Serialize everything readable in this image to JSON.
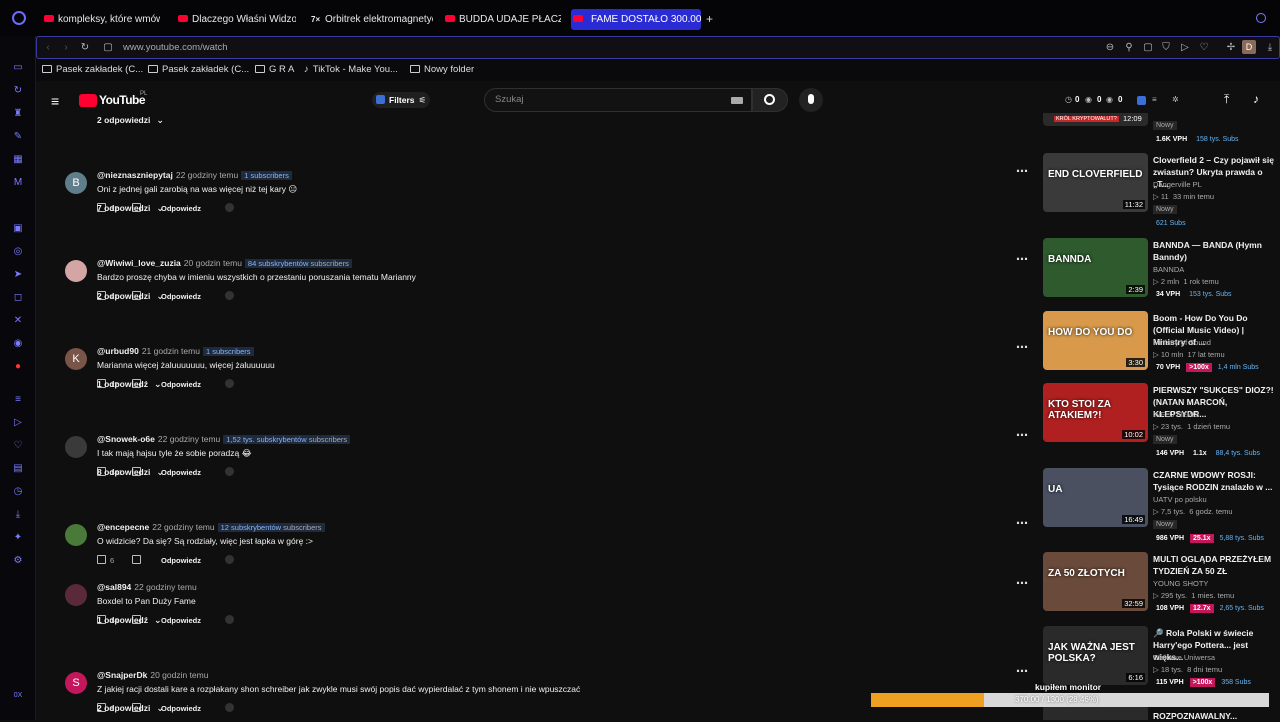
{
  "browser": {
    "tabs": [
      {
        "label": "kompleksy, które wmówiły",
        "yt": true
      },
      {
        "label": "Dlaczego Właśni Widzowie",
        "yt": true
      },
      {
        "label": "Orbitrek elektromagnetyczny",
        "yt": false
      },
      {
        "label": "BUDDA UDAJE PŁACZ I WY",
        "yt": true
      },
      {
        "label": "FAME DOSTAŁO 300.000",
        "yt": true,
        "active": true
      }
    ],
    "url": "www.youtube.com/watch",
    "profile_letter": "D",
    "bookmarks": [
      "Pasek zakładek (C...",
      "Pasek zakładek (C...",
      "G R A",
      "TikTok - Make You...",
      "Nowy folder"
    ],
    "sidebar_bottom_label": "0X"
  },
  "yt": {
    "logo": "YouTube",
    "logo_region": "PL",
    "filters_label": "Filters",
    "search_placeholder": "Szukaj",
    "header_counters": [
      "0",
      "0",
      "0"
    ]
  },
  "comments": [
    {
      "type": "replies",
      "label": "2 odpowiedzi"
    },
    {
      "type": "comment",
      "avatar": "B",
      "avatar_color": "#607d8b",
      "author": "@nieznaszniepytaj",
      "time": "22 godziny temu",
      "subs": "1 subscribers",
      "subs_extra": "",
      "text": "Oni z jednej gali zarobią na was więcej niż tej kary 😐",
      "likes": "32",
      "reply": "Odpowiedz"
    },
    {
      "type": "replies",
      "label": "7 odpowiedzi"
    },
    {
      "type": "comment",
      "avatar": "",
      "avatar_color": "#d4a5a5",
      "author": "@Wiwiwi_love_zuzia",
      "time": "20 godzin temu",
      "subs": "84 subskrybentów",
      "subs_extra": "subscribers",
      "text": "Bardzo proszę chyba w imieniu wszystkich o przestaniu poruszania tematu Marianny",
      "likes": "41",
      "reply": "Odpowiedz"
    },
    {
      "type": "replies",
      "label": "2 odpowiedzi"
    },
    {
      "type": "comment",
      "avatar": "K",
      "avatar_color": "#795548",
      "author": "@urbud90",
      "time": "21 godzin temu",
      "subs": "1 subscribers",
      "subs_extra": "",
      "text": "Marianna więcej żaluuuuuuu, więcej żaluuuuuu",
      "likes": "12",
      "reply": "Odpowiedz"
    },
    {
      "type": "replies",
      "label": "1 odpowiedź"
    },
    {
      "type": "comment",
      "avatar": "",
      "avatar_color": "#3a3a3a",
      "author": "@Snowek-o6e",
      "time": "22 godziny temu",
      "subs": "1,52 tys. subskrybentów",
      "subs_extra": "subscribers",
      "text": "I tak mają hajsu tyle że sobie poradzą 😂",
      "likes": "141",
      "reply": "Odpowiedz"
    },
    {
      "type": "replies",
      "label": "8 odpowiedzi"
    },
    {
      "type": "comment",
      "avatar": "",
      "avatar_color": "#4a7a3a",
      "author": "@encepecne",
      "time": "22 godziny temu",
      "subs": "12 subskrybentów",
      "subs_extra": "subscribers",
      "text": "O widzicie? Da się? Są rodziały, więc jest łapka w górę :>",
      "likes": "6",
      "reply": "Odpowiedz"
    },
    {
      "type": "comment",
      "avatar": "",
      "avatar_color": "#5a2a3a",
      "author": "@sal894",
      "time": "22 godziny temu",
      "subs": "",
      "subs_extra": "",
      "text": "Boxdel to Pan Duży Fame",
      "likes": "14",
      "reply": "Odpowiedz"
    },
    {
      "type": "replies",
      "label": "1 odpowiedź"
    },
    {
      "type": "comment",
      "avatar": "S",
      "avatar_color": "#c2185b",
      "author": "@SnajperDk",
      "time": "20 godzin temu",
      "subs": "",
      "subs_extra": "",
      "text": "Z jakiej racji dostali kare a rozpłakany shon schreiber jak zwykle musi swój popis dać wypierdalać z tym shonem i nie wpuszczać",
      "likes": "8",
      "reply": "Odpowiedz"
    },
    {
      "type": "replies",
      "label": "2 odpowiedzi"
    }
  ],
  "top_partial": {
    "chip": "KRÓL KRYPTOWALUT?",
    "time": "12:09",
    "new": "Nowy",
    "vph": "1.6K VPH",
    "subs": "158 tys. Subs"
  },
  "recommended": [
    {
      "title": "Cloverfield 2 – Czy pojawił się zwiastun? Ukryta prawda o „T...",
      "channel": "Dangerville PL",
      "views": "11",
      "ago": "33 min temu",
      "new": "Nowy",
      "vph": "",
      "ratio": "",
      "subs": "621 Subs",
      "duration": "11:32",
      "caption": "END CLOVERFIELD",
      "bg": "#3a3a3a"
    },
    {
      "title": "BANNDA — BANDA (Hymn Banndy)",
      "channel": "BANNDA",
      "views": "2 mln",
      "ago": "1 rok temu",
      "new": "",
      "vph": "34 VPH",
      "ratio": "",
      "subs": "153 tys. Subs",
      "duration": "2:39",
      "caption": "BANNDA",
      "bg": "#2e5a2e"
    },
    {
      "title": "Boom - How Do You Do (Official Music Video) | Ministry of ...",
      "channel": "Ministry of Sound",
      "views": "10 mln",
      "ago": "17 lat temu",
      "new": "",
      "vph": "70 VPH",
      "ratio": ">100x",
      "subs": "1,4 mln Subs",
      "duration": "3:30",
      "caption": "HOW DO YOU DO",
      "bg": "#d89a4a"
    },
    {
      "title": "PIERWSZY \"SUKCES\" DIOZ?! (NATAN MARCOŃ, KLEPSYDR...",
      "channel": "INFLU NEWS",
      "views": "23 tys.",
      "ago": "1 dzień temu",
      "new": "Nowy",
      "vph": "146 VPH",
      "ratio": "1.1x",
      "subs": "88,4 tys. Subs",
      "duration": "10:02",
      "caption": "KTO STOI ZA ATAKIEM?!",
      "bg": "#b02020"
    },
    {
      "title": "CZARNE WDOWY ROSJI: Tysiące RODZIN znalazło w ...",
      "channel": "UATV po polsku",
      "views": "7,5 tys.",
      "ago": "6 godz. temu",
      "new": "Nowy",
      "vph": "986 VPH",
      "ratio": "25.1x",
      "subs": "5,88 tys. Subs",
      "duration": "16:49",
      "caption": "UA",
      "bg": "#4a5060"
    },
    {
      "title": "MULTI OGLĄDA PRZEŻYŁEM TYDZIEŃ ZA 50 ZŁ",
      "channel": "YOUNG SHOTY",
      "views": "295 tys.",
      "ago": "1 mies. temu",
      "new": "",
      "vph": "108 VPH",
      "ratio": "12.7x",
      "subs": "2,65 tys. Subs",
      "duration": "32:59",
      "caption": "ZA 50 ZŁOTYCH",
      "bg": "#6a4a3a"
    },
    {
      "title": "🔎 Rola Polski w świecie Harry'ego Pottera... jest więks...",
      "channel": "Ciekawe Uniwersa",
      "views": "18 tys.",
      "ago": "8 dni temu",
      "new": "",
      "vph": "115 VPH",
      "ratio": ">100x",
      "subs": "358 Subs",
      "duration": "6:16",
      "caption": "JAK WAŻNA JEST POLSKA?",
      "bg": "#2a2a2a"
    }
  ],
  "bottom_partial_title": "ROZPOZNAWALNY...",
  "overlay": {
    "label": "kupiłem monitor",
    "progress_text": "370.00 / 1300 (28.46%)",
    "progress": 0.2846,
    "bar_color": "#f0a020"
  }
}
